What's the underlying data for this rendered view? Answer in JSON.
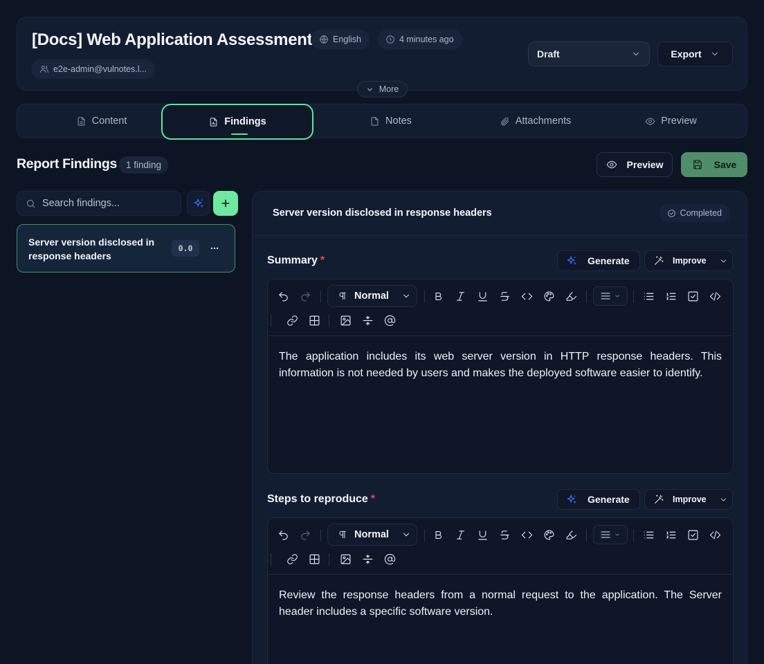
{
  "header": {
    "title": "[Docs] Web Application Assessment",
    "language": "English",
    "updated": "4 minutes ago",
    "user": "e2e-admin@vulnotes.l...",
    "status_select": "Draft",
    "export_label": "Export",
    "more_label": "More"
  },
  "tabs": [
    {
      "label": "Content",
      "icon": "document-icon"
    },
    {
      "label": "Findings",
      "icon": "file-chart-icon",
      "active": true
    },
    {
      "label": "Notes",
      "icon": "file-icon"
    },
    {
      "label": "Attachments",
      "icon": "paperclip-icon"
    },
    {
      "label": "Preview",
      "icon": "eye-icon"
    }
  ],
  "findings_page": {
    "title": "Report Findings",
    "count": "1 finding",
    "preview_label": "Preview",
    "save_label": "Save"
  },
  "sidebar": {
    "search_placeholder": "Search findings...",
    "findings": [
      {
        "title": "Server version disclosed in response headers",
        "score": "0.0"
      }
    ]
  },
  "detail": {
    "title": "Server version disclosed in response headers",
    "status": "Completed",
    "generate_label": "Generate",
    "improve_label": "Improve",
    "paragraph_style": "Normal",
    "fields": [
      {
        "label": "Summary",
        "required": "*",
        "text": "The application includes its web server version in HTTP response headers. This information is not needed by users and makes the deployed software easier to identify."
      },
      {
        "label": "Steps to reproduce",
        "required": "*",
        "text": "Review the response headers from a normal request to the application. The Server header includes a specific software version."
      }
    ]
  },
  "colors": {
    "background": "#0d1424",
    "card": "#131d32",
    "accent_green": "#5ee69a",
    "save_green": "#4f8e69",
    "ai_blue": "#3b6cf0",
    "required_red": "#e5484d"
  }
}
